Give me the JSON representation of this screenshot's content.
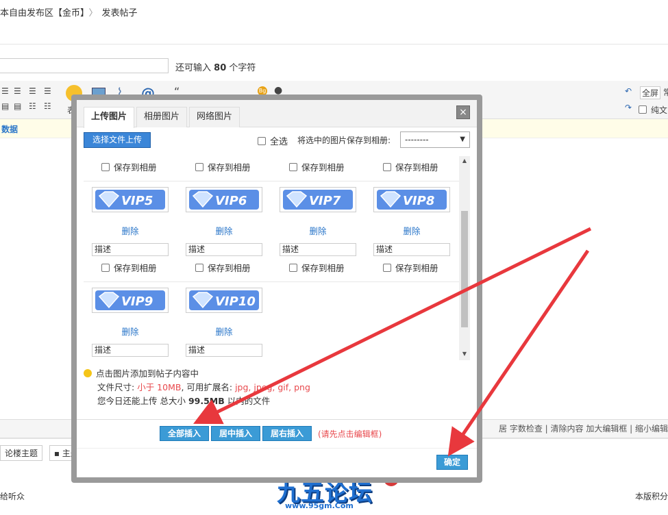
{
  "breadcrumb": {
    "forum": "本自由发布区【金币】",
    "sep": "〉",
    "page": "发表帖子"
  },
  "title_field": {
    "remaining_prefix": "还可输入",
    "remaining_count": "80",
    "remaining_suffix": "个字符"
  },
  "toolbar": {
    "emoji_label": "表",
    "fullscreen_label": "全屏",
    "plain_text_label": "纯文",
    "right_extra": "常"
  },
  "data_bar": {
    "label": "数据"
  },
  "bottom_links": {
    "text": "居   字数检查 | 清除内容   加大编辑框 | 缩小编辑"
  },
  "options": {
    "reply_topic": "论楼主题",
    "topic_label": "主题售"
  },
  "footer": {
    "left": "给听众",
    "right": "本版积分"
  },
  "logo": {
    "text": "九五论坛",
    "url_text": "www.95gm.Com"
  },
  "modal": {
    "tabs": [
      "上传图片",
      "相册图片",
      "网络图片"
    ],
    "close_icon": "×",
    "upload_button": "选择文件上传",
    "select_all": "全选",
    "save_to_album_label": "将选中的图片保存到相册:",
    "album_select_value": "--------",
    "save_label": "保存到相册",
    "delete_label": "删除",
    "desc_placeholder": "描述",
    "images": [
      "VIP5",
      "VIP6",
      "VIP7",
      "VIP8",
      "VIP9",
      "VIP10"
    ],
    "tips": {
      "line1": "点击图片添加到帖子内容中",
      "line2_prefix": "文件尺寸: ",
      "line2_size": "小于 10MB",
      "line2_mid": ", 可用扩展名: ",
      "line2_ext": "jpg, jpeg, gif, png",
      "line3_prefix": "您今日还能上传 总大小 ",
      "line3_size": "99.5MB",
      "line3_suffix": " 以内的文件"
    },
    "insert_all": "全部插入",
    "insert_center": "居中插入",
    "insert_right": "居右插入",
    "insert_hint": "(请先点击编辑框)",
    "ok_button": "确定"
  },
  "colors": {
    "accent": "#3b9bd6",
    "link": "#2a76c9",
    "warn": "#e8484c",
    "arrow": "#e8383d"
  }
}
